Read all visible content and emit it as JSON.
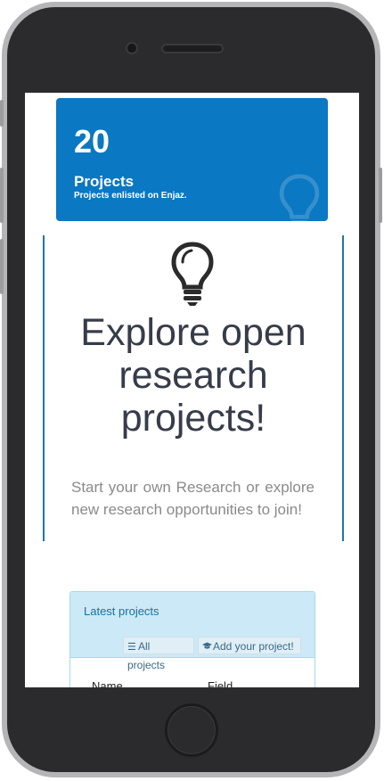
{
  "stats": {
    "count": "20",
    "label": "Projects",
    "description": "Projects enlisted on Enjaz."
  },
  "hero": {
    "title": "Explore open research projects!",
    "text": "Start your own Research or explore new research opportunities to join!"
  },
  "latest": {
    "title": "Latest projects",
    "all_projects": "All projects",
    "add_project": "Add your project!",
    "columns": [
      "Name",
      "Field"
    ]
  },
  "colors": {
    "accent": "#0a78c2",
    "panel_bg": "#cbe9f6",
    "hero_border": "#1f77a4"
  }
}
